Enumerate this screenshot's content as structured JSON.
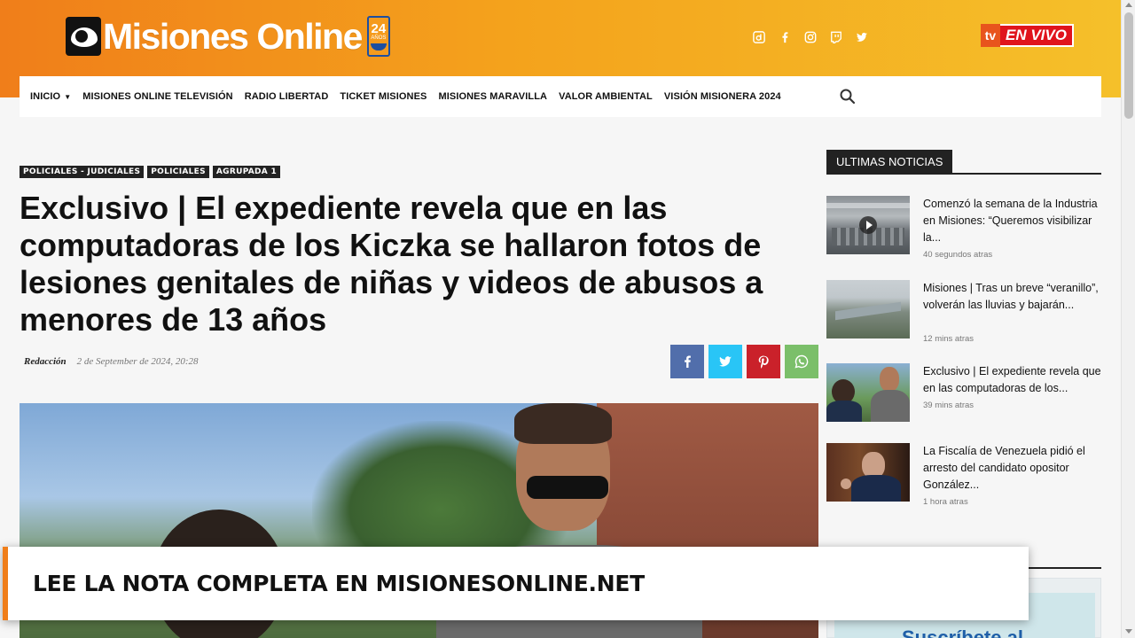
{
  "brand": {
    "name": "Misiones Online",
    "badge_number": "24",
    "badge_label": "AÑOS"
  },
  "header": {
    "social_icons": [
      "dailymotion-icon",
      "facebook-icon",
      "instagram-icon",
      "twitch-icon",
      "twitter-icon"
    ],
    "live": {
      "prefix": "tv",
      "label": "EN VIVO"
    }
  },
  "nav": {
    "items": [
      {
        "label": "INICIO",
        "has_dropdown": true
      },
      {
        "label": "MISIONES ONLINE TELEVISIÓN"
      },
      {
        "label": "RADIO LIBERTAD"
      },
      {
        "label": "TICKET MISIONES"
      },
      {
        "label": "MISIONES MARAVILLA"
      },
      {
        "label": "VALOR AMBIENTAL"
      },
      {
        "label": "VISIÓN MISIONERA 2024"
      }
    ],
    "search_icon": "search-icon"
  },
  "article": {
    "tags": [
      "POLICIALES - JUDICIALES",
      "POLICIALES",
      "AGRUPADA 1"
    ],
    "title": "Exclusivo | El expediente revela que en las computadoras de los Kiczka se hallaron fotos de lesiones genitales de niñas y videos de abusos a menores de 13 años",
    "author": "Redacción",
    "date": "2 de September de 2024, 20:28",
    "share": [
      {
        "icon": "facebook-icon",
        "color": "#516eab"
      },
      {
        "icon": "twitter-icon",
        "color": "#29c5f6"
      },
      {
        "icon": "pinterest-icon",
        "color": "#ca212a"
      },
      {
        "icon": "whatsapp-icon",
        "color": "#7bbf6a"
      }
    ]
  },
  "banner": {
    "text": "LEE LA NOTA COMPLETA EN MISIONESONLINE.NET"
  },
  "sidebar": {
    "title": "ULTIMAS NOTICIAS",
    "news": [
      {
        "title": "Comenzó la semana de la Industria en Misiones: “Queremos visibilizar la...",
        "time": "40 segundos atras",
        "has_video": true
      },
      {
        "title": "Misiones | Tras un breve “veranillo”, volverán las lluvias y bajarán...",
        "time": "12 mins atras"
      },
      {
        "title": "Exclusivo | El expediente revela que en las computadoras de los...",
        "time": "39 mins atras"
      },
      {
        "title": "La Fiscalía de Venezuela pidió el arresto del candidato opositor González...",
        "time": "1 hora atras"
      }
    ],
    "promo_text": "Suscríbete al"
  },
  "colors": {
    "header_start": "#f07e1a",
    "header_end": "#f5c02a",
    "live_red": "#e0141c",
    "dark": "#222222"
  }
}
